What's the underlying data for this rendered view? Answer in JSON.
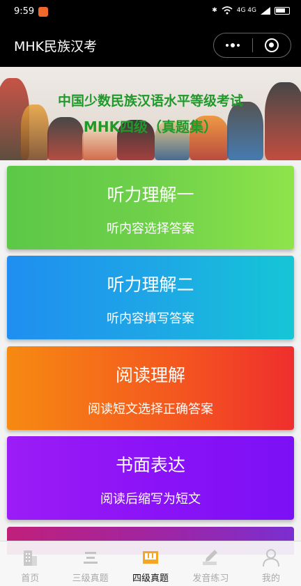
{
  "status": {
    "time": "9:59",
    "network": "4G 4G"
  },
  "nav": {
    "title": "MHK民族汉考"
  },
  "banner": {
    "line1": "中国少数民族汉语水平等级考试",
    "line2": "MHK四级（真题集）"
  },
  "cards": [
    {
      "title": "听力理解一",
      "subtitle": "听内容选择答案"
    },
    {
      "title": "听力理解二",
      "subtitle": "听内容填写答案"
    },
    {
      "title": "阅读理解",
      "subtitle": "阅读短文选择正确答案"
    },
    {
      "title": "书面表达",
      "subtitle": "阅读后缩写为短文"
    }
  ],
  "tabs": [
    {
      "label": "首页",
      "icon": "building-icon"
    },
    {
      "label": "三级真题",
      "icon": "three-icon"
    },
    {
      "label": "四级真题",
      "icon": "four-icon",
      "active": true
    },
    {
      "label": "发音练习",
      "icon": "pen-icon"
    },
    {
      "label": "我的",
      "icon": "user-icon"
    }
  ],
  "tab_glyphs": {
    "three": "三",
    "four": "四"
  },
  "colors": {
    "accent_active": "#f5a623",
    "banner_text": "#1f9a2a"
  }
}
